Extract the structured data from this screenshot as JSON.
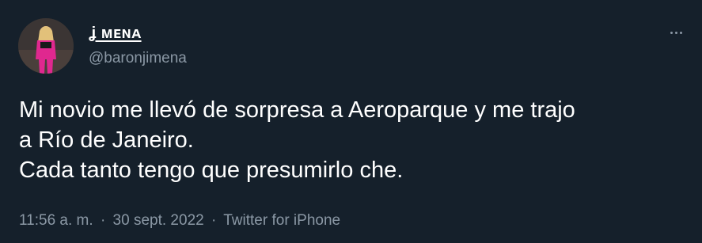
{
  "user": {
    "display_name": "ʝ ᴍᴇɴᴀ",
    "handle": "@baronjimena"
  },
  "tweet": {
    "lines": [
      "Mi novio me llevó de sorpresa a Aeroparque y me trajo",
      "a Río de Janeiro.",
      "Cada tanto tengo que presumirlo che."
    ]
  },
  "meta": {
    "time": "11:56 a. m.",
    "separator": "·",
    "date": "30 sept. 2022",
    "source": "Twitter for iPhone"
  },
  "icons": {
    "more": "more-options-icon"
  },
  "colors": {
    "background": "#15202b",
    "text": "#ffffff",
    "secondary": "#8b98a5"
  }
}
